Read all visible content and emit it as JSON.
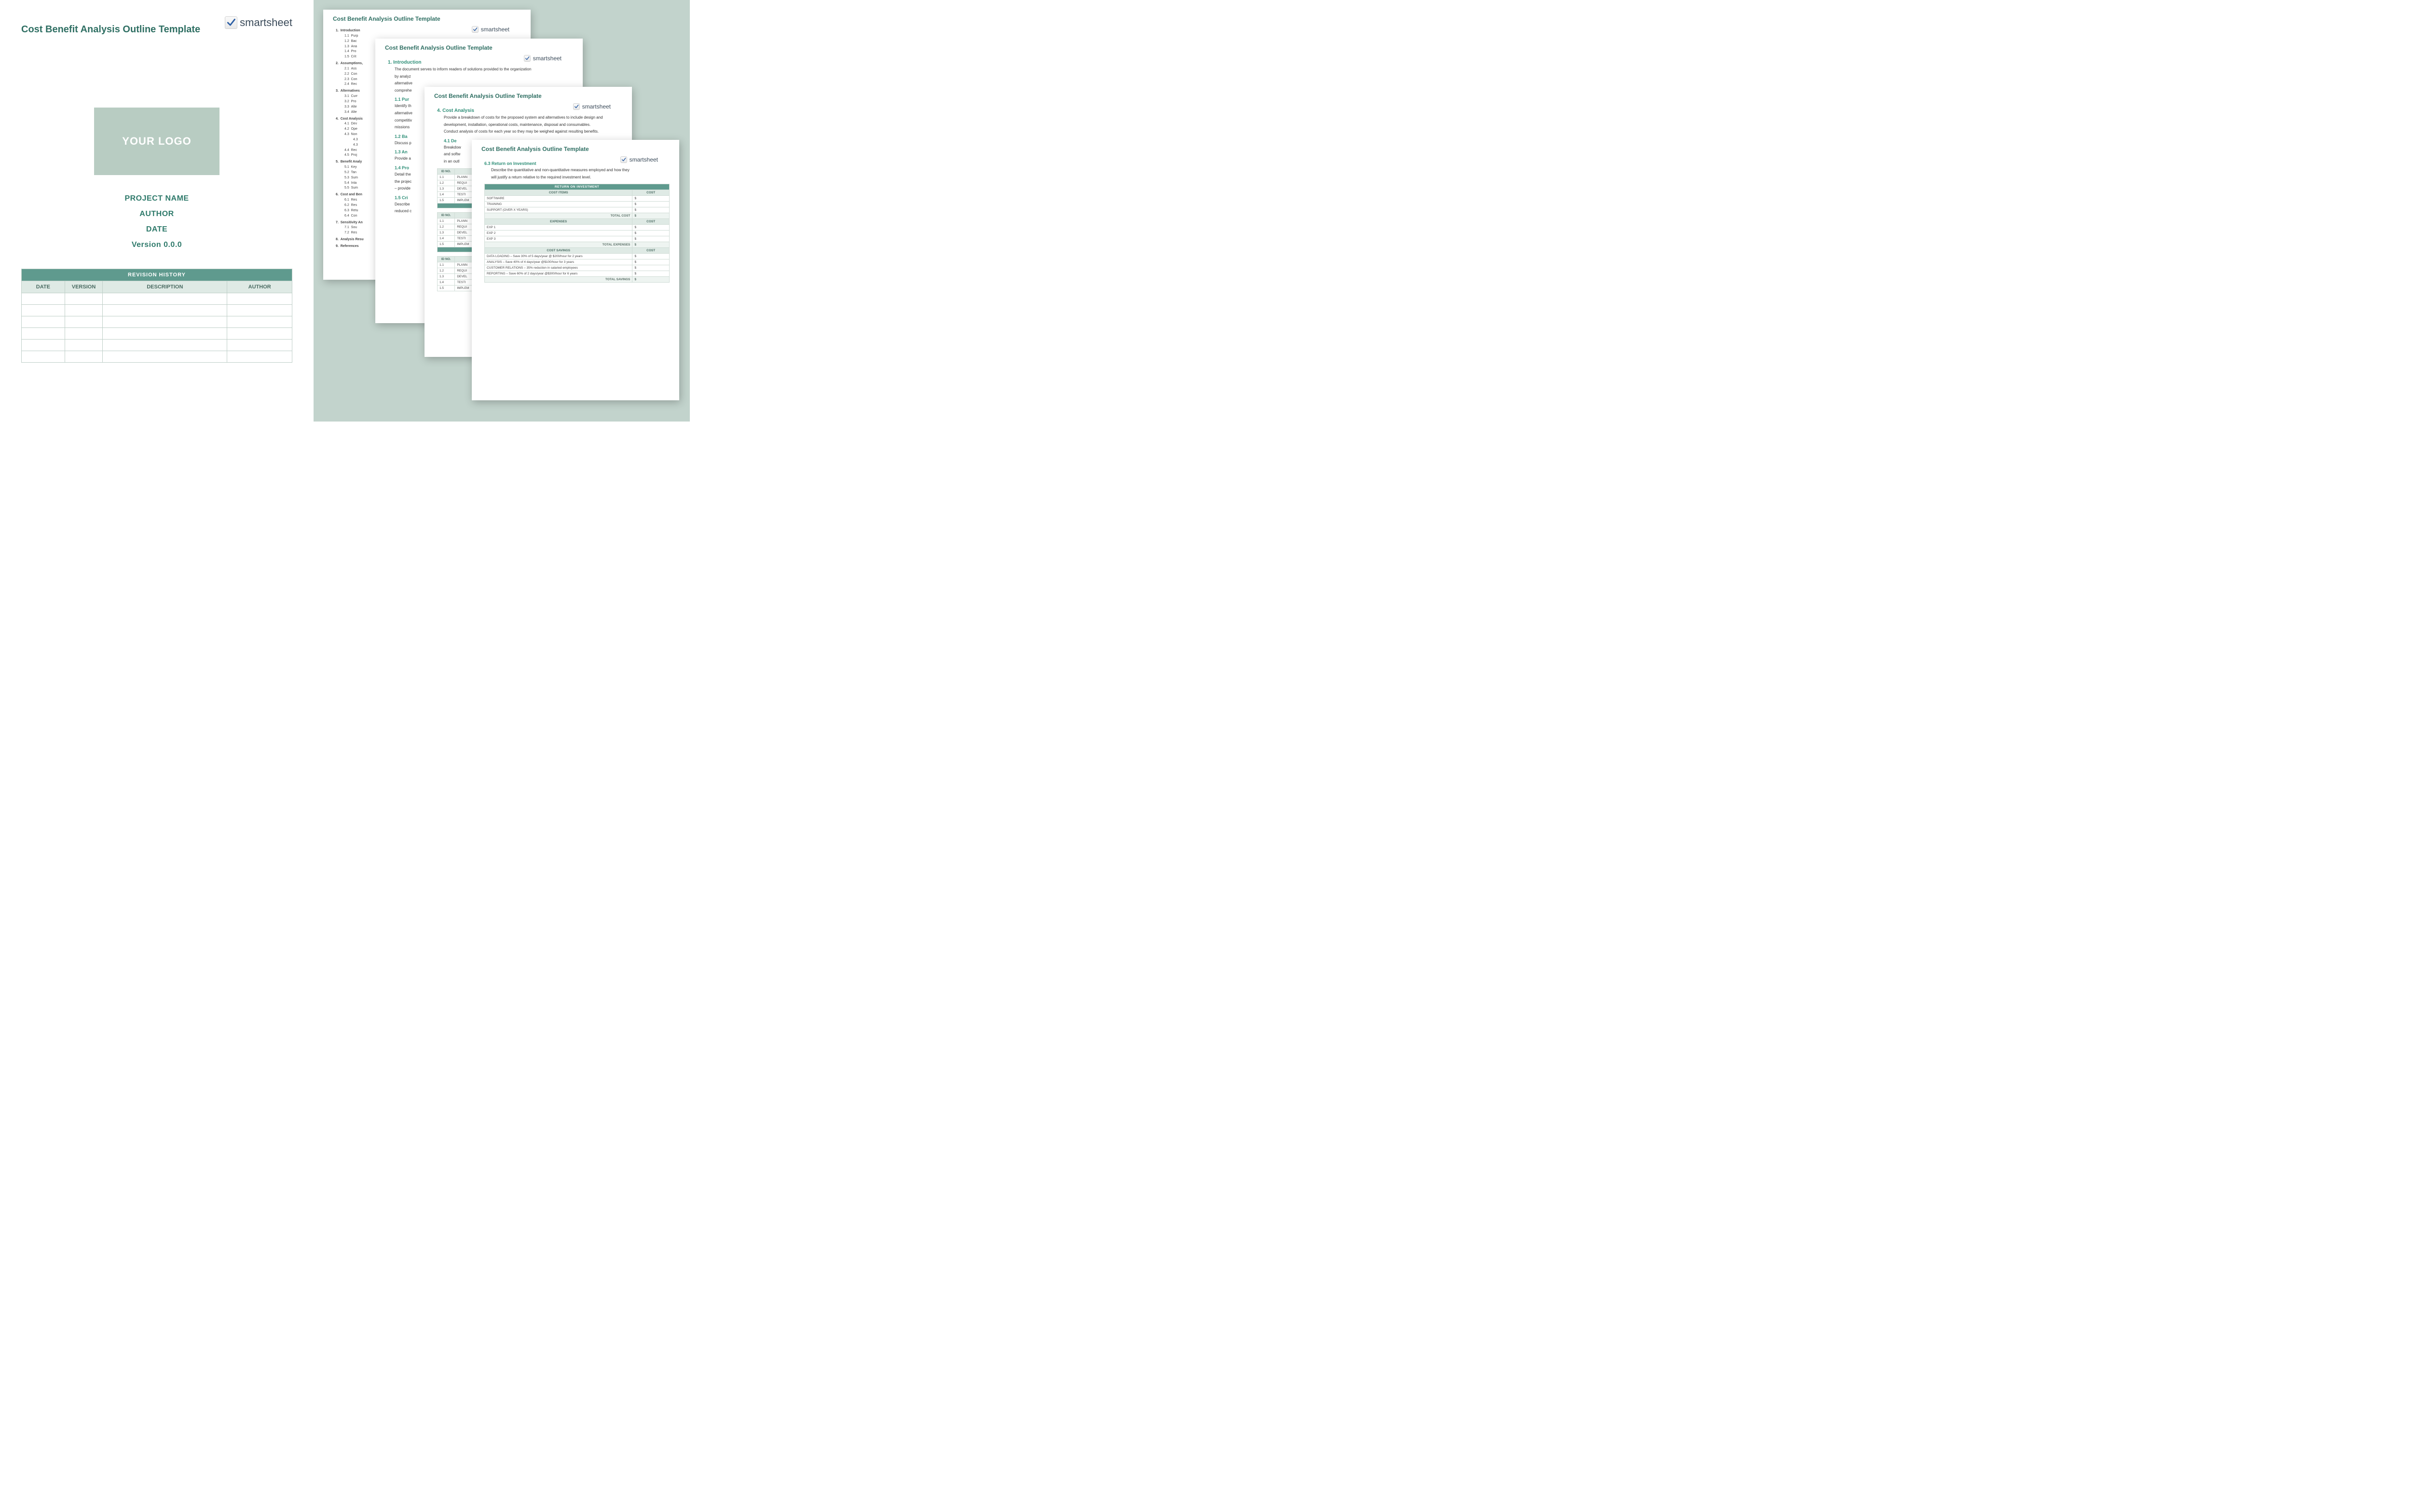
{
  "brand": {
    "name": "smartsheet"
  },
  "doc_title": "Cost Benefit Analysis Outline Template",
  "cover": {
    "logo_placeholder": "YOUR LOGO",
    "project_name": "PROJECT NAME",
    "author": "AUTHOR",
    "date": "DATE",
    "version": "Version 0.0.0"
  },
  "revision": {
    "title": "REVISION HISTORY",
    "cols": [
      "DATE",
      "VERSION",
      "DESCRIPTION",
      "AUTHOR"
    ],
    "blank_rows": 6
  },
  "outline": {
    "s1": {
      "n": "1.",
      "t": "Introduction"
    },
    "s11": {
      "n": "1.1",
      "t": "Purp"
    },
    "s12": {
      "n": "1.2",
      "t": "Bac"
    },
    "s13": {
      "n": "1.3",
      "t": "Ana"
    },
    "s14": {
      "n": "1.4",
      "t": "Pro"
    },
    "s15": {
      "n": "1.5",
      "t": "Crit"
    },
    "s2": {
      "n": "2.",
      "t": "Assumptions,"
    },
    "s21": {
      "n": "2.1",
      "t": "Ass"
    },
    "s22": {
      "n": "2.2",
      "t": "Con"
    },
    "s23": {
      "n": "2.3",
      "t": "Con"
    },
    "s24": {
      "n": "2.4",
      "t": "Rec"
    },
    "s3": {
      "n": "3.",
      "t": "Alternatives"
    },
    "s31": {
      "n": "3.1",
      "t": "Curr"
    },
    "s32": {
      "n": "3.2",
      "t": "Pro"
    },
    "s33": {
      "n": "3.3",
      "t": "Alte"
    },
    "s34": {
      "n": "3.4",
      "t": "Alte"
    },
    "s4": {
      "n": "4.",
      "t": "Cost Analysis"
    },
    "s41": {
      "n": "4.1",
      "t": "Dev"
    },
    "s42": {
      "n": "4.2",
      "t": "Ope"
    },
    "s43": {
      "n": "4.3",
      "t": "Non"
    },
    "s431": {
      "n": "4.3",
      "t": ""
    },
    "s432": {
      "n": "4.3",
      "t": ""
    },
    "s44": {
      "n": "4.4",
      "t": "Rec"
    },
    "s45": {
      "n": "4.5",
      "t": "Proj"
    },
    "s5": {
      "n": "5.",
      "t": "Benefit Analy"
    },
    "s51": {
      "n": "5.1",
      "t": "Key"
    },
    "s52": {
      "n": "5.2",
      "t": "Tan"
    },
    "s53": {
      "n": "5.3",
      "t": "Sum"
    },
    "s54": {
      "n": "5.4",
      "t": "Inta"
    },
    "s55": {
      "n": "5.5",
      "t": "Sum"
    },
    "s6": {
      "n": "6.",
      "t": "Cost and Ben"
    },
    "s61": {
      "n": "6.1",
      "t": "Res"
    },
    "s62": {
      "n": "6.2",
      "t": "Res"
    },
    "s63": {
      "n": "6.3",
      "t": "Retu"
    },
    "s64": {
      "n": "6.4",
      "t": "Con"
    },
    "s7": {
      "n": "7.",
      "t": "Sensitivity An"
    },
    "s71": {
      "n": "7.1",
      "t": "Sou"
    },
    "s72": {
      "n": "7.2",
      "t": "Res"
    },
    "s8": {
      "n": "8.",
      "t": "Analysis Resu"
    },
    "s9": {
      "n": "9.",
      "t": "References"
    }
  },
  "preview2": {
    "h1": "1. Introduction",
    "p1a": "The document serves to inform readers of solutions provided to the organization",
    "p1b": "by analyz",
    "p1c": "alternative",
    "p1d": "comprehe",
    "h11": "1.1  Pur",
    "p11a": "Identify th",
    "p11b": "alternative",
    "p11c": "competitiv",
    "p11d": "missions",
    "h12": "1.2  Ba",
    "p12a": "Discuss p",
    "h13": "1.3  An",
    "p13a": "Provide a",
    "h14": "1.4  Pro",
    "p14a": "Detail the",
    "p14b": "the projec",
    "p14c": "– provide",
    "h15": "1.5  Cri",
    "p15a": "Describe",
    "p15b": "reduced c"
  },
  "preview3": {
    "h4": "4. Cost Analysis",
    "p4a": "Provide a breakdown of costs for the proposed system and alternatives to include design and",
    "p4b": "development, installation, operational costs, maintenance, disposal and consumables.",
    "p4c": "Conduct analysis of costs for each year so they may be weighed against resulting benefits.",
    "h41": "4.1  De",
    "p41a": "Breakdow",
    "p41b": "and softw",
    "p41c": "in an outl",
    "idtable": {
      "hdr_id": "ID NO.",
      "rows": [
        {
          "id": "1.1",
          "t": "PLANN"
        },
        {
          "id": "1.2",
          "t": "REQUI"
        },
        {
          "id": "1.3",
          "t": "DEVEL"
        },
        {
          "id": "1.4",
          "t": "TESTI"
        },
        {
          "id": "1.5",
          "t": "IMPLEM"
        }
      ]
    }
  },
  "preview4": {
    "h63": "6.3  Return on Investment",
    "p63a": "Describe the quantitative and non-quantitative measures employed and how they",
    "p63b": "will justify a return relative to the required investment level.",
    "roi_title": "RETURN ON INVESTMENT",
    "cost_items_hdr": "COST ITEMS",
    "cost_hdr": "COST",
    "expenses_hdr": "EXPENSES",
    "savings_hdr": "COST SAVINGS",
    "total_cost": "TOTAL COST",
    "total_expenses": "TOTAL EXPENSES",
    "total_savings": "TOTAL SAVINGS",
    "currency": "$",
    "cost_items": [
      "SOFTWARE",
      "TRAINING",
      "SUPPORT (OVER X YEARS)"
    ],
    "expenses": [
      "EXP 1",
      "EXP 2",
      "EXP 3"
    ],
    "savings": [
      "DATA LOADING – Save 30% of 5 days/year @ $200/hour for 2 years",
      "ANALYSIS – Save 40% of 4 days/year @$100/hour for 3 years",
      "CUSTOMER RELATIONS – 35% reduction in salaried employees",
      "REPORTING – Save 60% of 2 days/year @$300/hour for 6 years"
    ]
  }
}
